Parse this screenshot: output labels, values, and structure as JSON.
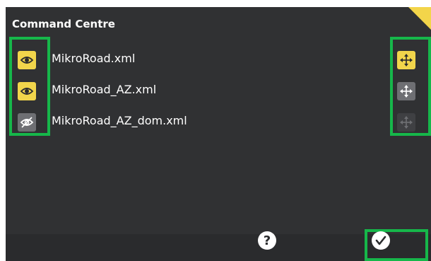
{
  "header": {
    "title": "Command Centre"
  },
  "files": [
    {
      "name": "MikroRoad.xml",
      "visibility_icon": "eye-icon",
      "visible": true,
      "move_state": "active"
    },
    {
      "name": "MikroRoad_AZ.xml",
      "visibility_icon": "eye-icon",
      "visible": true,
      "move_state": "available"
    },
    {
      "name": "MikroRoad_AZ_dom.xml",
      "visibility_icon": "eye-off-icon",
      "visible": false,
      "move_state": "disabled"
    }
  ],
  "footer": {
    "help_label": "?",
    "confirm_icon": "checkmark-icon"
  },
  "colors": {
    "accent": "#f1d54b",
    "highlight": "#16b74a",
    "panel": "#303133"
  }
}
